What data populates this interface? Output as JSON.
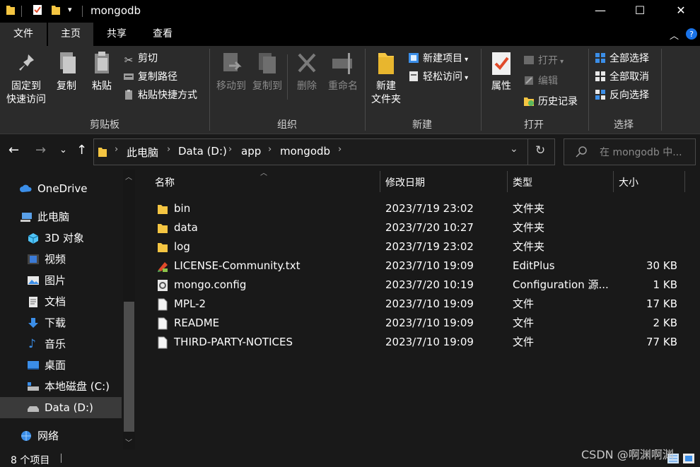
{
  "window": {
    "title": "mongodb",
    "minimize": "—",
    "maximize": "☐",
    "close": "✕"
  },
  "ribbon_tabs": {
    "file": "文件",
    "home": "主页",
    "share": "共享",
    "view": "查看"
  },
  "ribbon": {
    "clipboard": {
      "label": "剪贴板",
      "pin_line1": "固定到",
      "pin_line2": "快速访问",
      "copy": "复制",
      "paste": "粘贴",
      "cut": "剪切",
      "copy_path": "复制路径",
      "paste_shortcut": "粘贴快捷方式"
    },
    "organize": {
      "label": "组织",
      "move_to": "移动到",
      "copy_to": "复制到",
      "delete": "删除",
      "rename": "重命名"
    },
    "new": {
      "label": "新建",
      "new_folder_line1": "新建",
      "new_folder_line2": "文件夹",
      "new_item": "新建项目",
      "easy_access": "轻松访问"
    },
    "open": {
      "label": "打开",
      "properties": "属性",
      "open": "打开",
      "edit": "编辑",
      "history": "历史记录"
    },
    "select": {
      "label": "选择",
      "select_all": "全部选择",
      "select_none": "全部取消",
      "invert": "反向选择"
    }
  },
  "breadcrumb": [
    "此电脑",
    "Data (D:)",
    "app",
    "mongodb"
  ],
  "search": {
    "placeholder": "在 mongodb 中..."
  },
  "nav": {
    "onedrive": "OneDrive",
    "this_pc": "此电脑",
    "objects3d": "3D 对象",
    "videos": "视频",
    "pictures": "图片",
    "documents": "文档",
    "downloads": "下载",
    "music": "音乐",
    "desktop": "桌面",
    "drive_c": "本地磁盘 (C:)",
    "drive_d": "Data (D:)",
    "network": "网络"
  },
  "columns": {
    "name": "名称",
    "date": "修改日期",
    "type": "类型",
    "size": "大小"
  },
  "files": [
    {
      "name": "bin",
      "date": "2023/7/19 23:02",
      "type": "文件夹",
      "size": "",
      "icon": "folder-icon"
    },
    {
      "name": "data",
      "date": "2023/7/20 10:27",
      "type": "文件夹",
      "size": "",
      "icon": "folder-icon"
    },
    {
      "name": "log",
      "date": "2023/7/19 23:02",
      "type": "文件夹",
      "size": "",
      "icon": "folder-icon"
    },
    {
      "name": "LICENSE-Community.txt",
      "date": "2023/7/10 19:09",
      "type": "EditPlus",
      "size": "30 KB",
      "icon": "editplus-file-icon"
    },
    {
      "name": "mongo.config",
      "date": "2023/7/20 10:19",
      "type": "Configuration 源...",
      "size": "1 KB",
      "icon": "config-file-icon"
    },
    {
      "name": "MPL-2",
      "date": "2023/7/10 19:09",
      "type": "文件",
      "size": "17 KB",
      "icon": "file-icon"
    },
    {
      "name": "README",
      "date": "2023/7/10 19:09",
      "type": "文件",
      "size": "2 KB",
      "icon": "file-icon"
    },
    {
      "name": "THIRD-PARTY-NOTICES",
      "date": "2023/7/10 19:09",
      "type": "文件",
      "size": "77 KB",
      "icon": "file-icon"
    }
  ],
  "status": {
    "item_count": "8 个项目"
  },
  "watermark": "CSDN @啊渊啊渊",
  "colors": {
    "folder": "#f4c542",
    "accent": "#3b8ee8",
    "background": "#191919"
  }
}
